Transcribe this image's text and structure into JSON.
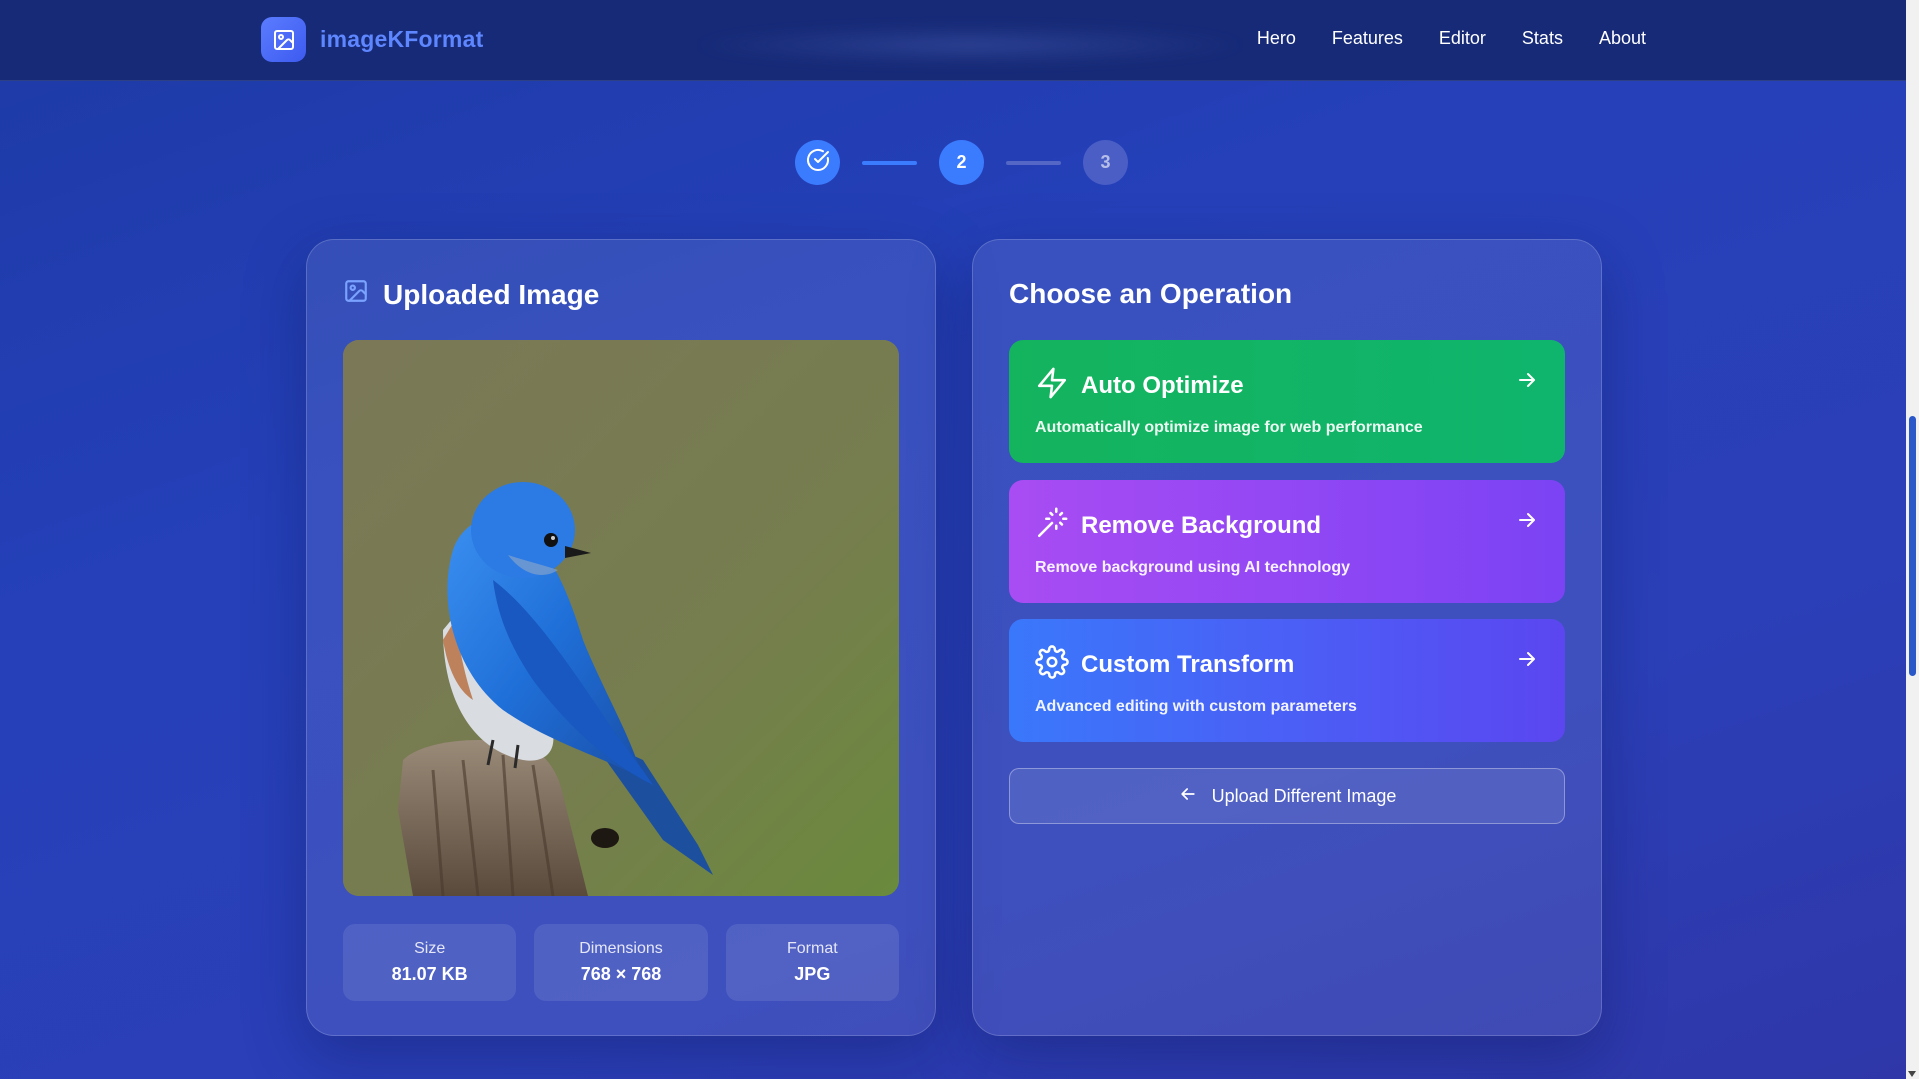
{
  "app": {
    "name": "imageKFormat",
    "logo_icon": "image-icon"
  },
  "nav": {
    "links": [
      "Hero",
      "Features",
      "Editor",
      "Stats",
      "About"
    ]
  },
  "stepper": {
    "steps": [
      {
        "state": "done",
        "icon": "check-circle-icon"
      },
      {
        "state": "active",
        "label": "2"
      },
      {
        "state": "pending",
        "label": "3"
      }
    ]
  },
  "uploaded": {
    "title": "Uploaded Image",
    "title_icon": "image-icon",
    "stats": [
      {
        "label": "Size",
        "value": "81.07 KB"
      },
      {
        "label": "Dimensions",
        "value": "768 × 768"
      },
      {
        "label": "Format",
        "value": "JPG"
      }
    ]
  },
  "operations": {
    "title": "Choose an Operation",
    "items": [
      {
        "title": "Auto Optimize",
        "desc": "Automatically optimize image for web performance",
        "icon": "lightning-icon",
        "color": "#14b35e"
      },
      {
        "title": "Remove Background",
        "desc": "Remove background using AI technology",
        "icon": "magic-wand-icon",
        "color": "#a94cf3"
      },
      {
        "title": "Custom Transform",
        "desc": "Advanced editing with custom parameters",
        "icon": "gear-icon",
        "color": "#3a78fb"
      }
    ],
    "upload_button": "Upload Different Image"
  },
  "colors": {
    "accent": "#3b7cff",
    "brand": "#5e86ff",
    "background": "#2540b9"
  }
}
